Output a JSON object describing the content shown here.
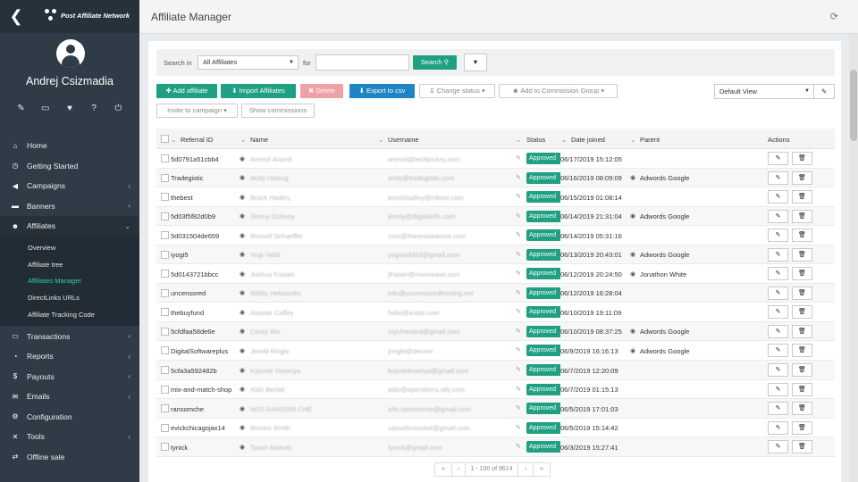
{
  "sidebar": {
    "brand": "Post Affiliate Network",
    "user_name": "Andrej Csizmadia",
    "tools": [
      "edit-icon",
      "monitor-icon",
      "heart-icon",
      "help-icon",
      "power-icon"
    ],
    "nav": [
      {
        "label": "Home",
        "icon": "⌂",
        "chev": ""
      },
      {
        "label": "Getting Started",
        "icon": "◷",
        "chev": ""
      },
      {
        "label": "Campaigns",
        "icon": "◀",
        "chev": "‹"
      },
      {
        "label": "Banners",
        "icon": "▬",
        "chev": "‹"
      },
      {
        "label": "Affiliates",
        "icon": "☻",
        "chev": "⌄"
      }
    ],
    "subnav": [
      {
        "label": "Overview"
      },
      {
        "label": "Affiliate tree"
      },
      {
        "label": "Affiliates Manager"
      },
      {
        "label": "DirectLinks URLs"
      },
      {
        "label": "Affiliate Tracking Code"
      }
    ],
    "nav2": [
      {
        "label": "Transactions",
        "icon": "▭",
        "chev": "‹"
      },
      {
        "label": "Reports",
        "icon": "◔",
        "chev": "‹"
      },
      {
        "label": "Payouts",
        "icon": "$",
        "chev": "‹"
      },
      {
        "label": "Emails",
        "icon": "✉",
        "chev": "‹"
      },
      {
        "label": "Configuration",
        "icon": "⚙",
        "chev": ""
      },
      {
        "label": "Tools",
        "icon": "✕",
        "chev": "‹"
      },
      {
        "label": "Offline sale",
        "icon": "⇄",
        "chev": ""
      }
    ]
  },
  "header": {
    "title": "Affiliate Manager"
  },
  "search": {
    "label_in": "Search in",
    "scope": "All Affiliates",
    "label_for": "for",
    "query": "",
    "button": "Search"
  },
  "toolbar": {
    "add": "Add affiliate",
    "import": "Import Affiliates",
    "delete": "Delete",
    "export": "Export to csv",
    "change_status": "Change status",
    "add_group": "Add to Commission Group",
    "view": "Default View",
    "invite": "Invite to campaign",
    "show_commissions": "Show commissions"
  },
  "table": {
    "columns": {
      "referral": "Referral ID",
      "name": "Name",
      "username": "Username",
      "status": "Status",
      "date": "Date joined",
      "parent": "Parent",
      "actions": "Actions"
    },
    "rows": [
      {
        "id": "5d0791a51cbb4",
        "name": "Animol Anand",
        "user": "animol@techjockey.com",
        "status": "Approved",
        "date": "06/17/2019 15:12:05",
        "parent": ""
      },
      {
        "id": "Tradegistic",
        "name": "Andy Hsieng",
        "user": "andy@tradegistic.com",
        "status": "Approved",
        "date": "06/16/2019 08:09:09",
        "parent": "Adwords Google"
      },
      {
        "id": "thebest",
        "name": "Brock Hadley",
        "user": "brockhadley@tnbest.com",
        "status": "Approved",
        "date": "06/15/2019 01:08:14",
        "parent": ""
      },
      {
        "id": "5d03f5f82d0b9",
        "name": "Jimmy Doheny",
        "user": "jimmy@digitalinfo.com",
        "status": "Approved",
        "date": "06/14/2019 21:31:04",
        "parent": "Adwords Google"
      },
      {
        "id": "5d031504de659",
        "name": "Russell Schaeffer",
        "user": "russ@theresawaome.com",
        "status": "Approved",
        "date": "06/14/2019 05:31:16",
        "parent": ""
      },
      {
        "id": "iyogi5",
        "name": "Yogi Vadd",
        "user": "yogivadd24@gmail.com",
        "status": "Approved",
        "date": "06/13/2019 20:43:01",
        "parent": "Adwords Google"
      },
      {
        "id": "5d0143721bbcc",
        "name": "Joshua Frasier",
        "user": "jfrasier@moosease.com",
        "status": "Approved",
        "date": "06/12/2019 20:24:50",
        "parent": "Jonathon White"
      },
      {
        "id": "uncensored",
        "name": "Ability Helsworks",
        "user": "info@uncensoredhosting.net",
        "status": "Approved",
        "date": "06/12/2019 16:28:04",
        "parent": ""
      },
      {
        "id": "thebuyfund",
        "name": "Alastair Coffey",
        "user": "hello@iinoib.com",
        "status": "Approved",
        "date": "06/10/2019 19:11:09",
        "parent": ""
      },
      {
        "id": "5cfdfaa58de6e",
        "name": "Carey Wu",
        "user": "mycfrtested@gmail.com",
        "status": "Approved",
        "date": "06/10/2019 08:37:25",
        "parent": "Adwords Google"
      },
      {
        "id": "DigitalSoftwareplus",
        "name": "Jerold Ringle",
        "user": "jringle@decnet",
        "status": "Approved",
        "date": "06/9/2019 16:16:13",
        "parent": "Adwords Google"
      },
      {
        "id": "5cfa3a592482b",
        "name": "Kejonte Yesenya",
        "user": "kejodefesenya@gmail.com",
        "status": "Approved",
        "date": "06/7/2019 12:20:09",
        "parent": ""
      },
      {
        "id": "mix-and-match-shop",
        "name": "Aldo Berlati",
        "user": "aldo@operations.olly.com",
        "status": "Approved",
        "date": "06/7/2019 01:15:13",
        "parent": ""
      },
      {
        "id": "ransomche",
        "name": "NOS RANSOM CHE",
        "user": "info.ransomche@gmail.com",
        "status": "Approved",
        "date": "06/5/2019 17:01:03",
        "parent": ""
      },
      {
        "id": "evickchicagojax14",
        "name": "Brooke Smith",
        "user": "vassoforsocket@gmail.com",
        "status": "Approved",
        "date": "06/5/2019 15:14:42",
        "parent": ""
      },
      {
        "id": "tynick",
        "name": "Tyson Nichols",
        "user": "tynick@gmail.com",
        "status": "Approved",
        "date": "06/3/2019 15:27:41",
        "parent": ""
      }
    ]
  },
  "pager": {
    "first": "«",
    "prev": "‹",
    "range": "1 - 100 of 9614",
    "next": "›",
    "last": "»"
  }
}
